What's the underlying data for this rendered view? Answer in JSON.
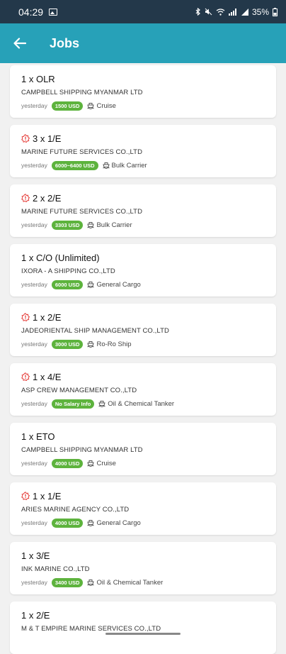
{
  "status_bar": {
    "time": "04:29",
    "battery": "35%"
  },
  "app_bar": {
    "title": "Jobs",
    "back_icon": "arrow-left-icon"
  },
  "colors": {
    "app_bar": "#27a1b8",
    "status_bar": "#23384a",
    "salary_badge": "#5db33d",
    "urgent": "#e53935"
  },
  "jobs": [
    {
      "title": "1 x OLR",
      "urgent": false,
      "company": "CAMPBELL SHIPPING MYANMAR LTD",
      "posted": "yesterday",
      "salary": "1500 USD",
      "ship_type": "Cruise"
    },
    {
      "title": "3 x 1/E",
      "urgent": true,
      "company": "MARINE FUTURE SERVICES CO.,LTD",
      "posted": "yesterday",
      "salary": "6000~6400 USD",
      "ship_type": "Bulk Carrier"
    },
    {
      "title": "2 x 2/E",
      "urgent": true,
      "company": "MARINE FUTURE SERVICES CO.,LTD",
      "posted": "yesterday",
      "salary": "3303 USD",
      "ship_type": "Bulk Carrier"
    },
    {
      "title": "1 x C/O (Unlimited)",
      "urgent": false,
      "company": "IXORA - A SHIPPING CO.,LTD",
      "posted": "yesterday",
      "salary": "6000 USD",
      "ship_type": "General Cargo"
    },
    {
      "title": "1 x 2/E",
      "urgent": true,
      "company": "JADEORIENTAL SHIP MANAGEMENT CO.,LTD",
      "posted": "yesterday",
      "salary": "3000 USD",
      "ship_type": "Ro-Ro Ship"
    },
    {
      "title": "1 x 4/E",
      "urgent": true,
      "company": "ASP CREW MANAGEMENT CO.,LTD",
      "posted": "yesterday",
      "salary": "No Salary Info",
      "ship_type": "Oil & Chemical Tanker"
    },
    {
      "title": "1 x ETO",
      "urgent": false,
      "company": "CAMPBELL SHIPPING MYANMAR LTD",
      "posted": "yesterday",
      "salary": "4000 USD",
      "ship_type": "Cruise"
    },
    {
      "title": "1 x 1/E",
      "urgent": true,
      "company": "ARIES MARINE AGENCY CO.,LTD",
      "posted": "yesterday",
      "salary": "4000 USD",
      "ship_type": "General Cargo"
    },
    {
      "title": "1 x 3/E",
      "urgent": false,
      "company": "INK MARINE CO.,LTD",
      "posted": "yesterday",
      "salary": "3400 USD",
      "ship_type": "Oil & Chemical Tanker"
    },
    {
      "title": "1 x 2/E",
      "urgent": false,
      "company": "M & T EMPIRE MARINE SERVICES CO.,LTD",
      "posted": "",
      "salary": "",
      "ship_type": ""
    }
  ]
}
